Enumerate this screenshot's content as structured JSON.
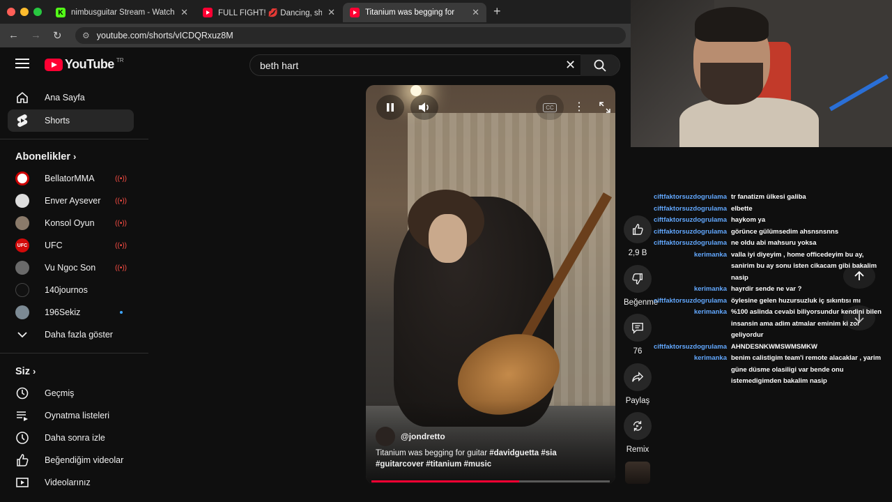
{
  "browser": {
    "tabs": [
      {
        "title": "nimbusguitar Stream - Watch",
        "favicon": "K"
      },
      {
        "title": "FULL FIGHT! 💋 Dancing, sho",
        "favicon": "yt"
      },
      {
        "title": "Titanium was begging for",
        "favicon": "yt"
      }
    ],
    "url": "youtube.com/shorts/vICDQRxuz8M"
  },
  "header": {
    "logo_text": "YouTube",
    "country_code": "TR",
    "search_value": "beth hart"
  },
  "sidebar": {
    "main": [
      {
        "label": "Ana Sayfa",
        "icon": "home-icon"
      },
      {
        "label": "Shorts",
        "icon": "shorts-icon"
      }
    ],
    "subscriptions_title": "Abonelikler",
    "subscriptions": [
      {
        "label": "BellatorMMA",
        "status": "live"
      },
      {
        "label": "Enver Aysever",
        "status": "live"
      },
      {
        "label": "Konsol Oyun",
        "status": "live"
      },
      {
        "label": "UFC",
        "status": "live"
      },
      {
        "label": "Vu Ngoc Son",
        "status": "live"
      },
      {
        "label": "140journos",
        "status": ""
      },
      {
        "label": "196Sekiz",
        "status": "new"
      }
    ],
    "show_more": "Daha fazla göster",
    "you_title": "Siz",
    "you_items": [
      {
        "label": "Geçmiş",
        "icon": "history-icon"
      },
      {
        "label": "Oynatma listeleri",
        "icon": "playlist-icon"
      },
      {
        "label": "Daha sonra izle",
        "icon": "clock-icon"
      },
      {
        "label": "Beğendiğim videolar",
        "icon": "thumbs-up-icon"
      },
      {
        "label": "Videolarınız",
        "icon": "your-videos-icon"
      }
    ]
  },
  "short": {
    "channel": "@jondretto",
    "caption_plain": "Titanium was begging for guitar ",
    "hashtags_line1": "#davidguetta #sia",
    "hashtags_line2": "#guitarcover #titanium #music",
    "progress": 0.62
  },
  "actions": {
    "like_count": "2,9 B",
    "dislike_label": "Beğenme",
    "comment_count": "76",
    "share_label": "Paylaş",
    "remix_label": "Remix"
  },
  "chat": [
    {
      "user": "ciftfaktorsuzdogrulama",
      "msg": "tr fanatizm ülkesi galiba"
    },
    {
      "user": "ciftfaktorsuzdogrulama",
      "msg": "elbette"
    },
    {
      "user": "ciftfaktorsuzdogrulama",
      "msg": "haykom ya"
    },
    {
      "user": "ciftfaktorsuzdogrulama",
      "msg": "görünce gülümsedim ahsnsnsnns"
    },
    {
      "user": "ciftfaktorsuzdogrulama",
      "msg": "ne oldu abi mahsuru yoksa"
    },
    {
      "user": "kerimanka",
      "msg": "valla iyi diyeyim , home officedeyim bu ay, sanirim bu ay sonu isten cikacam gibi bakalim nasip"
    },
    {
      "user": "kerimanka",
      "msg": "hayrdir sende ne var ?"
    },
    {
      "user": "ciftfaktorsuzdogrulama",
      "msg": "öylesine gelen huzursuzluk iç sıkıntısı mı"
    },
    {
      "user": "kerimanka",
      "msg": "%100 aslinda cevabi biliyorsundur kendini bilen insansin ama adim atmalar eminim ki zor geliyordur"
    },
    {
      "user": "ciftfaktorsuzdogrulama",
      "msg": "AHNDESNKWMSWMSMKW"
    },
    {
      "user": "kerimanka",
      "msg": "benim calistigim team'i remote alacaklar , yarim güne düsme olasiligi var bende onu istemedigimden bakalim nasip"
    }
  ],
  "colors": {
    "accent_red": "#ff0033",
    "chat_user": "#62a8ff",
    "live_red": "#ff4e45"
  }
}
